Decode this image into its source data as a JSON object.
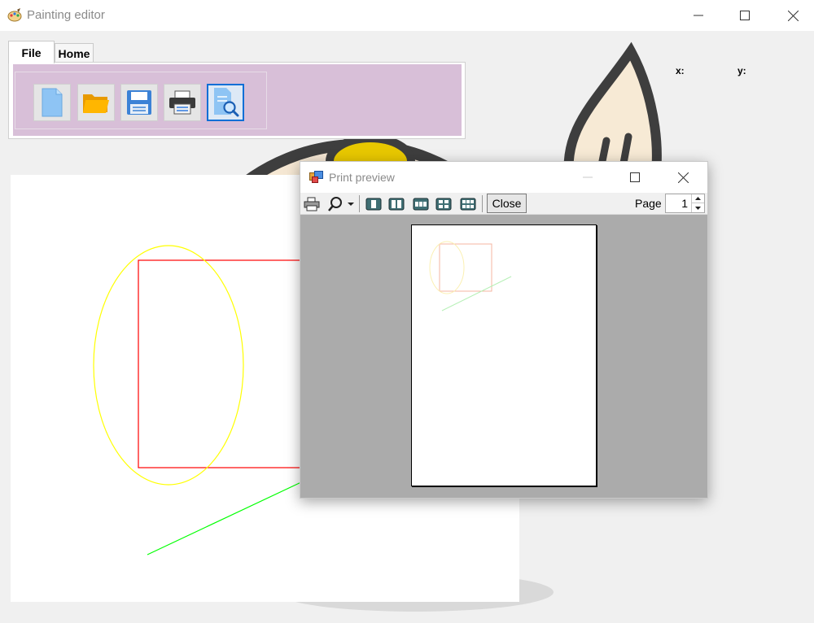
{
  "window": {
    "title": "Painting editor",
    "icons": {
      "app": "paint-palette-icon",
      "minimize": "minimize-icon",
      "maximize": "maximize-icon",
      "close": "close-icon"
    }
  },
  "ribbon": {
    "tabs": [
      {
        "label": "File",
        "active": true
      },
      {
        "label": "Home",
        "active": false
      }
    ],
    "file_buttons": [
      {
        "icon": "new-document-icon"
      },
      {
        "icon": "open-folder-icon"
      },
      {
        "icon": "save-icon"
      },
      {
        "icon": "print-icon"
      },
      {
        "icon": "print-preview-icon",
        "selected": true
      }
    ],
    "background_color": "#d8bfd8"
  },
  "coords": {
    "x_label": "x:",
    "y_label": "y:",
    "x_value": "",
    "y_value": ""
  },
  "canvas": {
    "shapes": [
      {
        "type": "ellipse",
        "color": "#ffff00"
      },
      {
        "type": "rectangle",
        "color": "#ff0000"
      },
      {
        "type": "line",
        "color": "#00ff00"
      }
    ]
  },
  "print_preview": {
    "title": "Print preview",
    "toolbar": {
      "print_icon": "printer-icon",
      "zoom_icon": "zoom-magnifier-icon",
      "layout_icons": [
        "one-page-icon",
        "two-pages-icon",
        "three-pages-icon",
        "four-pages-icon",
        "six-pages-icon"
      ],
      "close_label": "Close",
      "page_label": "Page",
      "page_value": "1"
    }
  }
}
